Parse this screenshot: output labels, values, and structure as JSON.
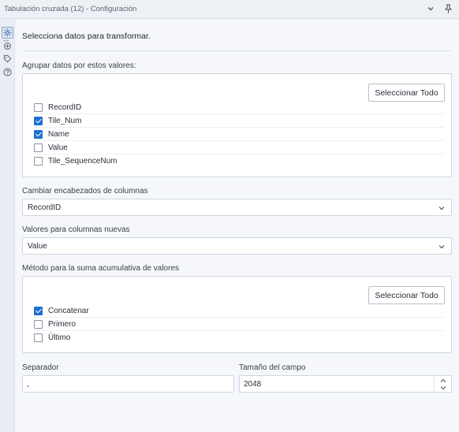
{
  "window": {
    "title": "Tabulación cruzada (12) - Configuración"
  },
  "main": {
    "intro": "Selecciona datos para transformar.",
    "group_by": {
      "label": "Agrupar datos por estos valores:",
      "select_all_label": "Seleccionar Todo",
      "fields": [
        {
          "label": "RecordID",
          "checked": false
        },
        {
          "label": "Tile_Num",
          "checked": true
        },
        {
          "label": "Name",
          "checked": true
        },
        {
          "label": "Value",
          "checked": false
        },
        {
          "label": "Tile_SequenceNum",
          "checked": false
        }
      ]
    },
    "change_headers": {
      "label": "Cambiar encabezados de columnas",
      "selected": "RecordID"
    },
    "new_values": {
      "label": "Valores para columnas nuevas",
      "selected": "Value"
    },
    "aggregation": {
      "label": "Método para la suma acumulativa de valores",
      "select_all_label": "Seleccionar Todo",
      "methods": [
        {
          "label": "Concatenar",
          "checked": true
        },
        {
          "label": "Primero",
          "checked": false
        },
        {
          "label": "Último",
          "checked": false
        }
      ]
    },
    "separator": {
      "label": "Separador",
      "value": ","
    },
    "field_size": {
      "label": "Tamaño del campo",
      "value": "2048"
    }
  },
  "icons": {
    "rail": [
      "gear-icon",
      "tool-icon",
      "tag-icon",
      "help-icon"
    ],
    "titlebar": [
      "chevron-down-icon",
      "pin-icon"
    ]
  },
  "colors": {
    "accent": "#1f6fd1",
    "panel_bg": "#f5f7fa"
  }
}
